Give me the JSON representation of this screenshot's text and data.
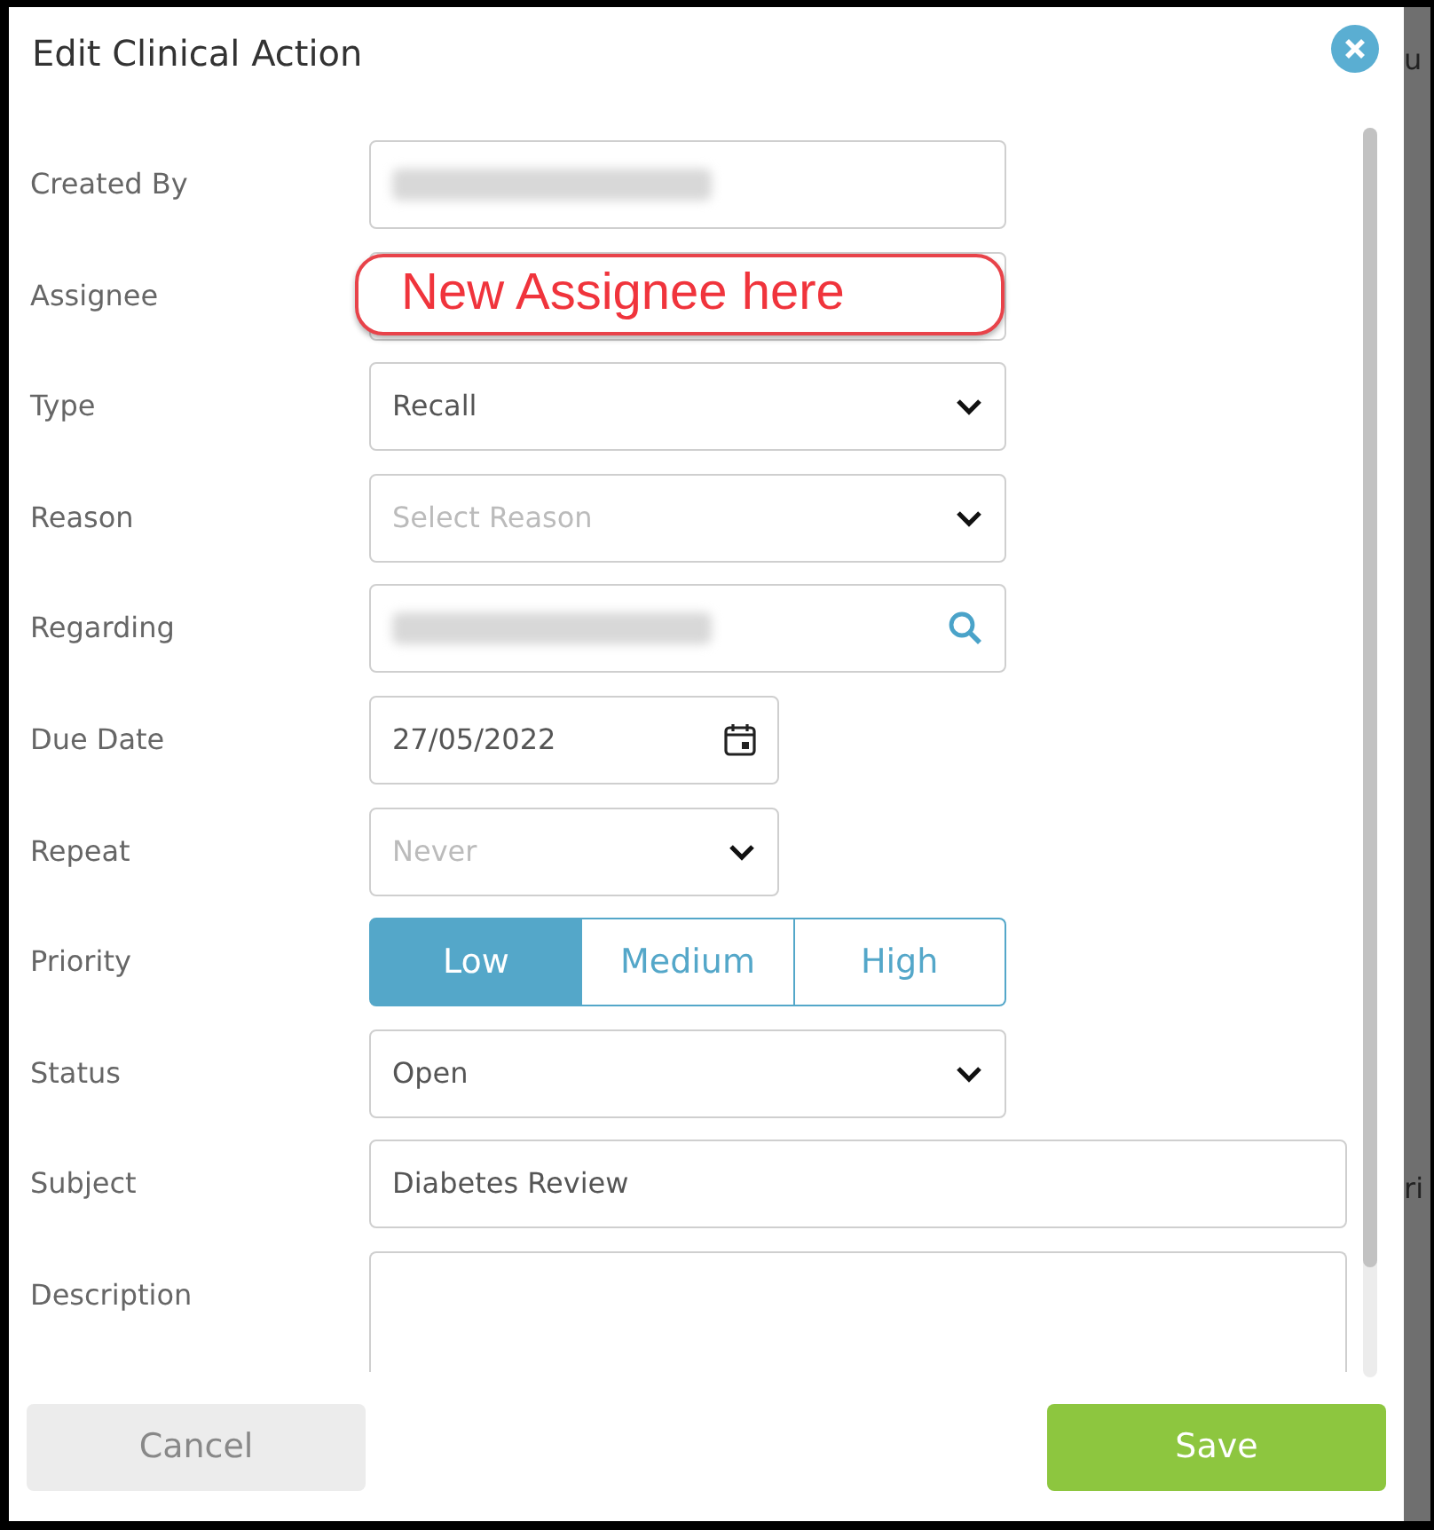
{
  "dialog": {
    "title": "Edit Clinical Action"
  },
  "fields": [
    {
      "label": "Created By",
      "kind": "text",
      "blurred": true
    },
    {
      "label": "Assignee",
      "kind": "text",
      "annotation": "New Assignee here"
    },
    {
      "label": "Type",
      "kind": "select",
      "value": "Recall"
    },
    {
      "label": "Reason",
      "kind": "select",
      "placeholder": "Select Reason"
    },
    {
      "label": "Regarding",
      "kind": "search",
      "blurred": true
    },
    {
      "label": "Due Date",
      "kind": "date",
      "value": "27/05/2022"
    },
    {
      "label": "Repeat",
      "kind": "compact_select",
      "placeholder": "Never"
    },
    {
      "label": "Priority",
      "kind": "segmented",
      "options": [
        {
          "label": "Low",
          "selected": true
        },
        {
          "label": "Medium",
          "selected": false
        },
        {
          "label": "High",
          "selected": false
        }
      ]
    },
    {
      "label": "Status",
      "kind": "select",
      "value": "Open"
    },
    {
      "label": "Subject",
      "kind": "wide_text",
      "value": "Diabetes Review"
    },
    {
      "label": "Description",
      "kind": "textarea"
    }
  ],
  "buttons": [
    {
      "label": "Cancel",
      "kind": "secondary"
    },
    {
      "label": "Save",
      "kind": "primary"
    }
  ],
  "background_fragments": [
    "u",
    "ri"
  ]
}
